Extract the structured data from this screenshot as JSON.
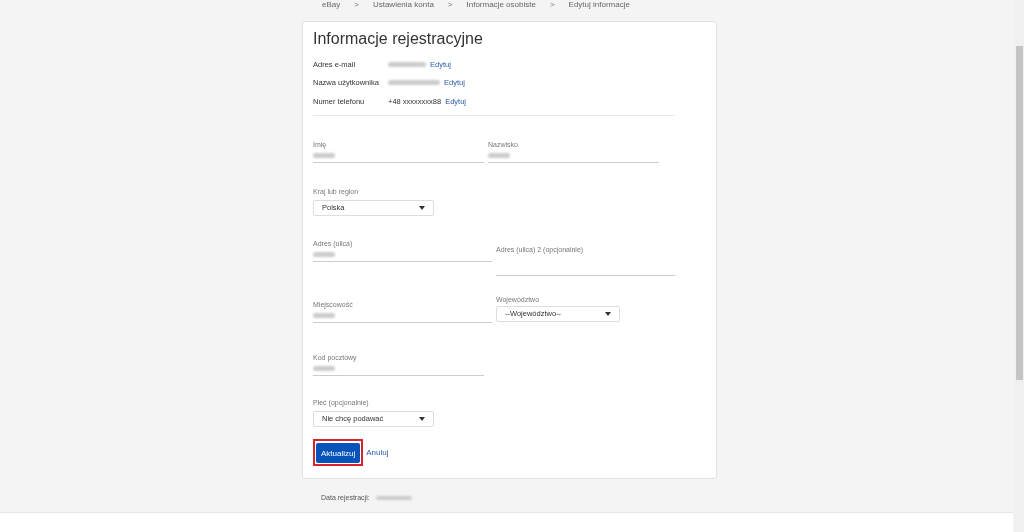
{
  "breadcrumb": {
    "separator": ">",
    "items": [
      "eBay",
      "Ustawienia konta",
      "Informacje osobiste",
      "Edytuj informacje"
    ]
  },
  "card": {
    "title": "Informacje rejestracyjne",
    "account_rows": [
      {
        "label": "Adres e-mail",
        "redacted": true,
        "edit": "Edytuj"
      },
      {
        "label": "Nazwa użytkownika",
        "redacted": true,
        "edit": "Edytuj"
      },
      {
        "label": "Numer telefonu",
        "value": "+48 xxxxxxxx88",
        "redacted": false,
        "edit": "Edytuj"
      }
    ],
    "form_rows": [
      {
        "fields": [
          {
            "kind": "text",
            "label": "Imię",
            "redacted": true
          },
          {
            "kind": "text",
            "label": "Nazwisko",
            "redacted": true
          }
        ]
      },
      {
        "fields": [
          {
            "kind": "select",
            "label": "Kraj lub region",
            "value": "Polska"
          }
        ]
      },
      {
        "fields": [
          {
            "kind": "text",
            "label": "Adres (ulica)",
            "redacted": true
          },
          {
            "kind": "text",
            "label": "Adres (ulica) 2 (opcjonalnie)",
            "redacted": false
          }
        ]
      },
      {
        "fields": [
          {
            "kind": "text",
            "label": "Miejscowość",
            "redacted": true
          },
          {
            "kind": "select",
            "label": "Województwo",
            "value": "--Województwo--"
          }
        ]
      },
      {
        "fields": [
          {
            "kind": "text",
            "label": "Kod pocztowy",
            "redacted": true
          }
        ]
      },
      {
        "fields": [
          {
            "kind": "select",
            "label": "Płeć (opcjonalnie)",
            "value": "Nie chcę podawać"
          }
        ]
      }
    ],
    "submit": "Aktualizuj",
    "cancel": "Anuluj"
  },
  "registration": {
    "label": "Data rejestracji:",
    "redacted": true
  }
}
